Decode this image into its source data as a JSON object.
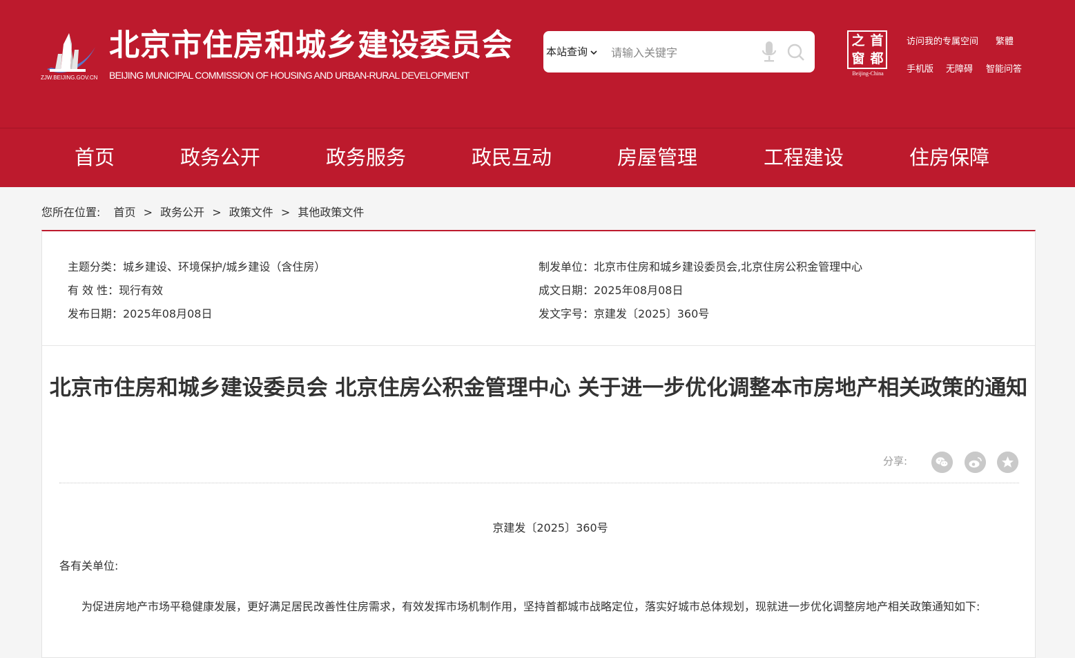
{
  "header": {
    "logo_url": "ZJW.BEIJING.GOV.CN",
    "title": "北京市住房和城乡建设委员会",
    "subtitle": "BEIJING MUNICIPAL COMMISSION OF HOUSING AND URBAN-RURAL DEVELOPMENT",
    "search_scope": "本站查询",
    "search_placeholder": "请输入关键字",
    "capital_chars": [
      "之",
      "首",
      "窗",
      "都"
    ],
    "capital_label": "Beijing-China",
    "links_row1": [
      "访问我的专属空间",
      "繁體"
    ],
    "links_row2": [
      "手机版",
      "无障碍",
      "智能问答"
    ]
  },
  "nav": {
    "items": [
      "首页",
      "政务公开",
      "政务服务",
      "政民互动",
      "房屋管理",
      "工程建设",
      "住房保障"
    ]
  },
  "breadcrumb": {
    "prefix": "您所在位置:",
    "items": [
      "首页",
      "政务公开",
      "政策文件",
      "其他政策文件"
    ],
    "separator": ">"
  },
  "meta": {
    "topic": "主题分类：城乡建设、环境保护/城乡建设（含住房）",
    "validity": "有 效 性：现行有效",
    "publish_date": "发布日期：2025年08月08日",
    "issuer": "制发单位：北京市住房和城乡建设委员会,北京住房公积金管理中心",
    "written_date": "成文日期：2025年08月08日",
    "doc_number": "发文字号：京建发〔2025〕360号"
  },
  "article": {
    "title": "北京市住房和城乡建设委员会 北京住房公积金管理中心 关于进一步优化调整本市房地产相关政策的通知",
    "share_label": "分享:",
    "docno": "京建发〔2025〕360号",
    "greeting": "各有关单位:",
    "para1": "为促进房地产市场平稳健康发展，更好满足居民改善性住房需求，有效发挥市场机制作用，坚持首都城市战略定位，落实好城市总体规划，现就进一步优化调整房地产相关政策通知如下:"
  },
  "colors": {
    "brand_red": "#bd1a2d",
    "share_grey": "#c9c9c9"
  }
}
